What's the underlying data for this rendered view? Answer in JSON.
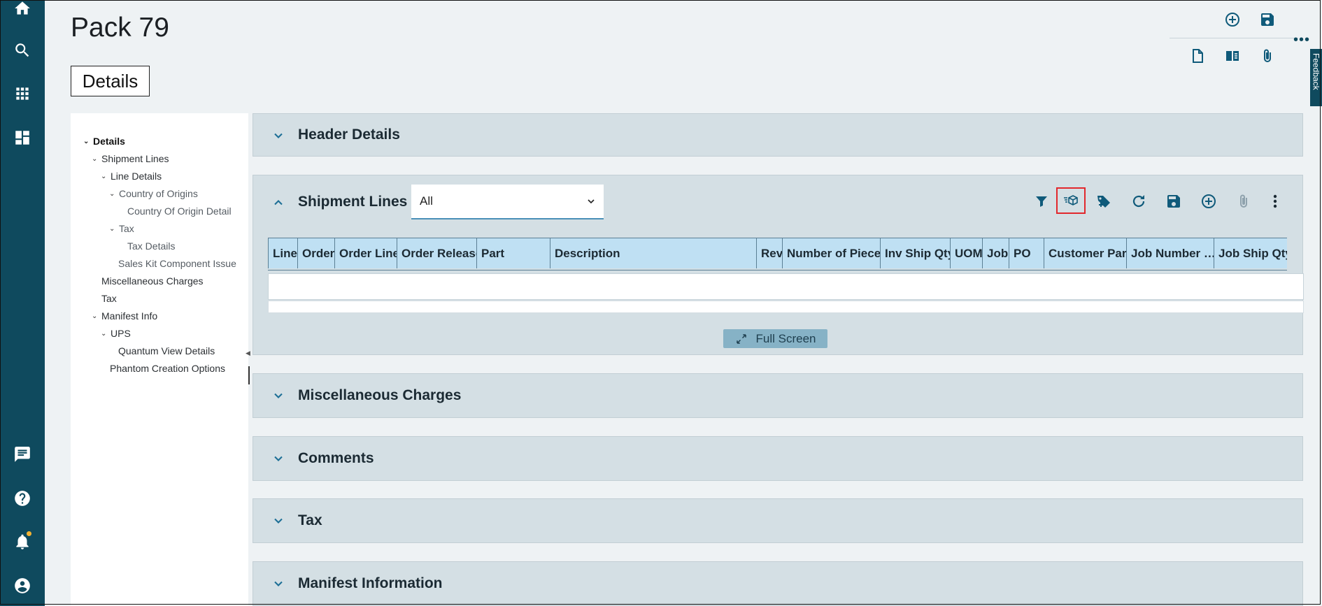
{
  "page": {
    "title": "Pack 79",
    "active_tab": "Details"
  },
  "rail": {
    "icons": [
      "home-icon",
      "search-icon",
      "apps-grid-icon",
      "dashboard-icon",
      "chat-icon",
      "help-icon",
      "bell-icon",
      "account-icon"
    ]
  },
  "top_toolbar": {
    "icons": [
      "add-circle-icon",
      "save-icon",
      "new-document-icon",
      "book-icon",
      "paperclip-icon"
    ],
    "more": "•••",
    "feedback": "Feedback"
  },
  "tree": {
    "items": [
      {
        "label": "Details",
        "bold": true,
        "caret": "⌄"
      },
      {
        "label": "Shipment Lines",
        "caret": "⌄"
      },
      {
        "label": "Line Details",
        "caret": "⌄"
      },
      {
        "label": "Country of Origins",
        "caret": "⌄",
        "muted": true
      },
      {
        "label": "Country Of Origin Detail",
        "muted": true
      },
      {
        "label": "Tax",
        "caret": "⌄",
        "muted": true
      },
      {
        "label": "Tax Details",
        "muted": true
      },
      {
        "label": "Sales Kit Component Issue",
        "muted": true
      },
      {
        "label": "Miscellaneous Charges"
      },
      {
        "label": "Tax"
      },
      {
        "label": "Manifest Info",
        "caret": "⌄"
      },
      {
        "label": "UPS",
        "caret": "⌄"
      },
      {
        "label": "Quantum View Details"
      },
      {
        "label": "Phantom Creation Options"
      }
    ]
  },
  "panels": {
    "header_details": {
      "title": "Header Details"
    },
    "shipment_lines": {
      "title": "Shipment Lines",
      "filter_value": "All",
      "toolbar_icons": [
        "filter-icon",
        "pack-box-icon",
        "tag-add-icon",
        "refresh-icon",
        "save-icon",
        "add-circle-icon",
        "paperclip-icon",
        "more-vertical-icon"
      ],
      "columns": [
        "Line",
        "Order",
        "Order Line",
        "Order Release",
        "Part",
        "Description",
        "Rev",
        "Number of Pieces",
        "Inv Ship Qty",
        "UOM",
        "Job",
        "PO",
        "Customer Part",
        "Job Number …",
        "Job Ship Qty"
      ],
      "fullscreen_label": "Full Screen"
    },
    "misc_charges": {
      "title": "Miscellaneous Charges"
    },
    "comments": {
      "title": "Comments"
    },
    "tax": {
      "title": "Tax"
    },
    "manifest": {
      "title": "Manifest Information"
    }
  }
}
